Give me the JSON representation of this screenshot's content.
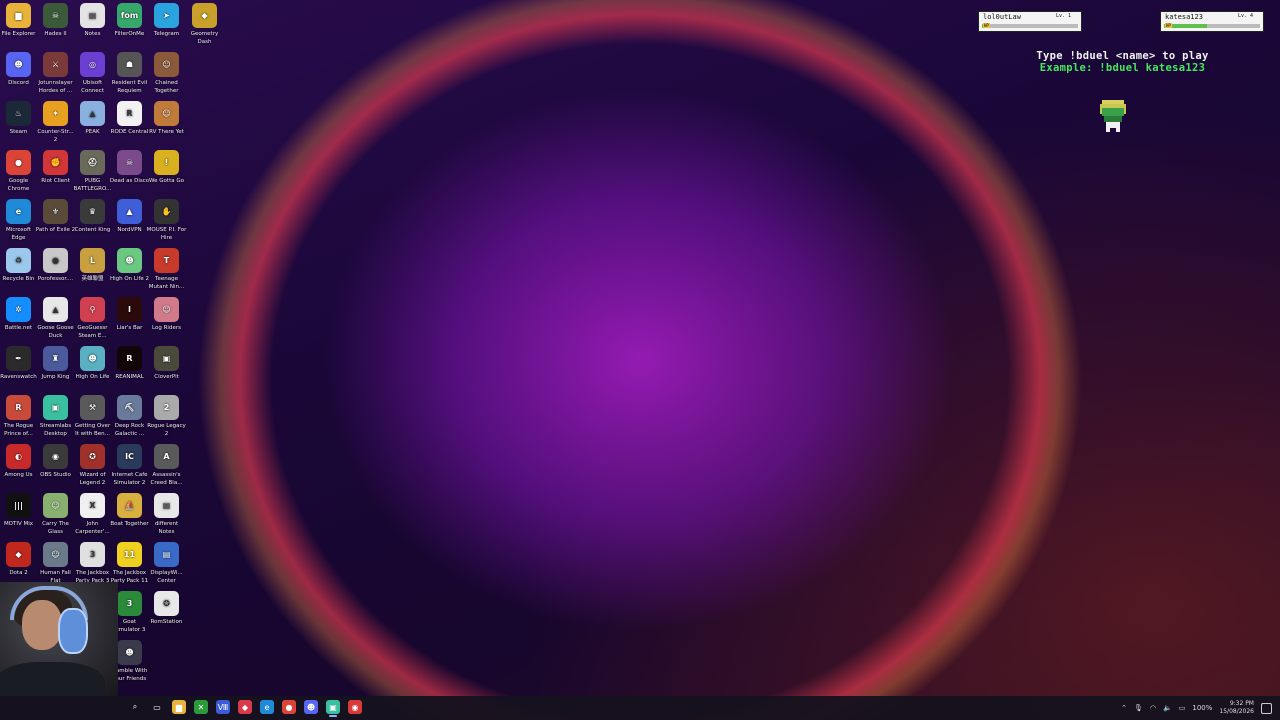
{
  "desktop": {
    "icons": [
      {
        "label": "File Explorer",
        "col": 0,
        "row": 0,
        "color": "#e8b33a",
        "glyph": "▆"
      },
      {
        "label": "Hades II",
        "col": 1,
        "row": 0,
        "color": "#3a5a3a",
        "glyph": "☠"
      },
      {
        "label": "Notes",
        "col": 2,
        "row": 0,
        "color": "#e4e4e4",
        "glyph": "▤"
      },
      {
        "label": "FilterOnMe",
        "col": 3,
        "row": 0,
        "color": "#36a86b",
        "glyph": "fom"
      },
      {
        "label": "Telegram",
        "col": 4,
        "row": 0,
        "color": "#2aa3df",
        "glyph": "➤"
      },
      {
        "label": "Geometry Dash",
        "col": 5,
        "row": 0,
        "color": "#c9a12a",
        "glyph": "◆"
      },
      {
        "label": "Discord",
        "col": 0,
        "row": 1,
        "color": "#5865f2",
        "glyph": "☻"
      },
      {
        "label": "Jotunnslayer Hordes of ...",
        "col": 1,
        "row": 1,
        "color": "#7a3a3a",
        "glyph": "⚔"
      },
      {
        "label": "Ubisoft Connect",
        "col": 2,
        "row": 1,
        "color": "#6b3fd1",
        "glyph": "◎"
      },
      {
        "label": "Resident Evil Requiem",
        "col": 3,
        "row": 1,
        "color": "#555",
        "glyph": "☗"
      },
      {
        "label": "Chained Together",
        "col": 4,
        "row": 1,
        "color": "#8a5a3a",
        "glyph": "☺"
      },
      {
        "label": "Steam",
        "col": 0,
        "row": 2,
        "color": "#1b2838",
        "glyph": "♨"
      },
      {
        "label": "Counter-Str... 2",
        "col": 1,
        "row": 2,
        "color": "#e8a020",
        "glyph": "✦"
      },
      {
        "label": "PEAK",
        "col": 2,
        "row": 2,
        "color": "#8ab0e0",
        "glyph": "▲"
      },
      {
        "label": "RODE Central",
        "col": 3,
        "row": 2,
        "color": "#f2f2f2",
        "glyph": "R"
      },
      {
        "label": "RV There Yet",
        "col": 4,
        "row": 2,
        "color": "#c07a3a",
        "glyph": "☺"
      },
      {
        "label": "Google Chrome",
        "col": 0,
        "row": 3,
        "color": "#db4437",
        "glyph": "●"
      },
      {
        "label": "Riot Client",
        "col": 1,
        "row": 3,
        "color": "#d13639",
        "glyph": "✊"
      },
      {
        "label": "PUBG BATTLEGRO...",
        "col": 2,
        "row": 3,
        "color": "#6a6a5a",
        "glyph": "⛑"
      },
      {
        "label": "Dead as Disco",
        "col": 3,
        "row": 3,
        "color": "#7a4a8a",
        "glyph": "☠"
      },
      {
        "label": "We Gotta Go",
        "col": 4,
        "row": 3,
        "color": "#d8b020",
        "glyph": "!"
      },
      {
        "label": "Microsoft Edge",
        "col": 0,
        "row": 4,
        "color": "#1e8ad8",
        "glyph": "e"
      },
      {
        "label": "Path of Exile 2",
        "col": 1,
        "row": 4,
        "color": "#5a4a3a",
        "glyph": "⚜"
      },
      {
        "label": "Content King",
        "col": 2,
        "row": 4,
        "color": "#3a3a3a",
        "glyph": "♛"
      },
      {
        "label": "NordVPN",
        "col": 3,
        "row": 4,
        "color": "#3e5fd8",
        "glyph": "▲"
      },
      {
        "label": "MOUSE P.I. For Hire",
        "col": 4,
        "row": 4,
        "color": "#333",
        "glyph": "✋"
      },
      {
        "label": "Recycle Bin",
        "col": 0,
        "row": 5,
        "color": "#9bc8ec",
        "glyph": "♻"
      },
      {
        "label": "Porofessor....",
        "col": 1,
        "row": 5,
        "color": "#c8c8c8",
        "glyph": "●"
      },
      {
        "label": "英雄聯盟",
        "col": 2,
        "row": 5,
        "color": "#c8a040",
        "glyph": "L"
      },
      {
        "label": "High On Life 2",
        "col": 3,
        "row": 5,
        "color": "#6ac880",
        "glyph": "☻"
      },
      {
        "label": "Teenage Mutant Nin...",
        "col": 4,
        "row": 5,
        "color": "#c83a2a",
        "glyph": "T"
      },
      {
        "label": "Battle.net",
        "col": 0,
        "row": 6,
        "color": "#148eff",
        "glyph": "✲"
      },
      {
        "label": "Goose Goose Duck",
        "col": 1,
        "row": 6,
        "color": "#e8e8e8",
        "glyph": "▲"
      },
      {
        "label": "GeoGuessr Steam E...",
        "col": 2,
        "row": 6,
        "color": "#d04050",
        "glyph": "⚲"
      },
      {
        "label": "Liar's Bar",
        "col": 3,
        "row": 6,
        "color": "#2a0a0a",
        "glyph": "I"
      },
      {
        "label": "Log Riders",
        "col": 4,
        "row": 6,
        "color": "#d07a8a",
        "glyph": "☺"
      },
      {
        "label": "Ravenswatch",
        "col": 0,
        "row": 7,
        "color": "#2a2a2a",
        "glyph": "✒"
      },
      {
        "label": "Jump King",
        "col": 1,
        "row": 7,
        "color": "#4a5a9a",
        "glyph": "♜"
      },
      {
        "label": "High On Life",
        "col": 2,
        "row": 7,
        "color": "#5ab0c0",
        "glyph": "☻"
      },
      {
        "label": "REANIMAL",
        "col": 3,
        "row": 7,
        "color": "#110505",
        "glyph": "R"
      },
      {
        "label": "CloverPit",
        "col": 4,
        "row": 7,
        "color": "#4a4a3a",
        "glyph": "▣"
      },
      {
        "label": "The Rogue Prince of...",
        "col": 0,
        "row": 8,
        "color": "#c84a3a",
        "glyph": "R"
      },
      {
        "label": "Streamlabs Desktop",
        "col": 1,
        "row": 8,
        "color": "#3ac0a0",
        "glyph": "▣"
      },
      {
        "label": "Getting Over It with Ben...",
        "col": 2,
        "row": 8,
        "color": "#5a5a5a",
        "glyph": "⚒"
      },
      {
        "label": "Deep Rock Galactic ...",
        "col": 3,
        "row": 8,
        "color": "#6a7a9a",
        "glyph": "⛏"
      },
      {
        "label": "Rogue Legacy 2",
        "col": 4,
        "row": 8,
        "color": "#aaaaaa",
        "glyph": "2"
      },
      {
        "label": "Among Us",
        "col": 0,
        "row": 9,
        "color": "#c82a2a",
        "glyph": "◐"
      },
      {
        "label": "OBS Studio",
        "col": 1,
        "row": 9,
        "color": "#3a3a3a",
        "glyph": "◉"
      },
      {
        "label": "Wizard of Legend 2",
        "col": 2,
        "row": 9,
        "color": "#a0302a",
        "glyph": "✪"
      },
      {
        "label": "Internet Cafe Simulator 2",
        "col": 3,
        "row": 9,
        "color": "#2a3a5a",
        "glyph": "IC"
      },
      {
        "label": "Assassin's Creed Bla...",
        "col": 4,
        "row": 9,
        "color": "#5a5a5a",
        "glyph": "A"
      },
      {
        "label": "MOTIV Mix",
        "col": 0,
        "row": 10,
        "color": "#111",
        "glyph": "|||"
      },
      {
        "label": "Carry The Glass",
        "col": 1,
        "row": 10,
        "color": "#8ab070",
        "glyph": "☺"
      },
      {
        "label": "John Carpenter'...",
        "col": 2,
        "row": 10,
        "color": "#f0f0f0",
        "glyph": "X"
      },
      {
        "label": "Boat Together",
        "col": 3,
        "row": 10,
        "color": "#d8b040",
        "glyph": "⛵"
      },
      {
        "label": "different Notes",
        "col": 4,
        "row": 10,
        "color": "#e8e8e8",
        "glyph": "▤"
      },
      {
        "label": "Dota 2",
        "col": 0,
        "row": 11,
        "color": "#c0281e",
        "glyph": "◆"
      },
      {
        "label": "Human Fall Flat",
        "col": 1,
        "row": 11,
        "color": "#6a7a8a",
        "glyph": "☺"
      },
      {
        "label": "The Jackbox Party Pack 3",
        "col": 2,
        "row": 11,
        "color": "#e0e0e0",
        "glyph": "3"
      },
      {
        "label": "The Jackbox Party Pack 11",
        "col": 3,
        "row": 11,
        "color": "#f0d020",
        "glyph": "11"
      },
      {
        "label": "DisplayWi... Center",
        "col": 4,
        "row": 11,
        "color": "#3a6ac8",
        "glyph": "▤"
      },
      {
        "label": "Goat Simulator 3",
        "col": 3,
        "row": 12,
        "color": "#2a8a3a",
        "glyph": "3"
      },
      {
        "label": "RomStation",
        "col": 4,
        "row": 12,
        "color": "#e8e8e8",
        "glyph": "✪"
      },
      {
        "label": "Gamble With Your Friends",
        "col": 3,
        "row": 13,
        "color": "#3a3a4a",
        "glyph": "☻"
      }
    ]
  },
  "overlay": {
    "players": [
      {
        "name": "lol0utLaw",
        "level": "Lv. 1",
        "hp_label": "HP",
        "hp_fraction": 0.05
      },
      {
        "name": "katesa123",
        "level": "Lv. 4",
        "hp_label": "HP",
        "hp_fraction": 0.45
      }
    ],
    "instruction_line1": "Type !bduel <name> to play",
    "instruction_line2": "Example: !bduel katesa123"
  },
  "taskbar": {
    "icons": [
      {
        "name": "search-icon",
        "glyph": "⌕",
        "color": "transparent"
      },
      {
        "name": "task-view-icon",
        "glyph": "▭",
        "color": "transparent"
      },
      {
        "name": "file-explorer-icon",
        "glyph": "▆",
        "color": "#e8b33a"
      },
      {
        "name": "xbox-icon",
        "glyph": "✕",
        "color": "#2a9a3a"
      },
      {
        "name": "app-icon",
        "glyph": "Ⅷ",
        "color": "#3a5ad8"
      },
      {
        "name": "app-icon-red",
        "glyph": "◆",
        "color": "#d83a4a"
      },
      {
        "name": "edge-icon",
        "glyph": "e",
        "color": "#1e8ad8"
      },
      {
        "name": "chrome-icon",
        "glyph": "●",
        "color": "#db4437"
      },
      {
        "name": "discord-icon",
        "glyph": "☻",
        "color": "#5865f2"
      },
      {
        "name": "streamlabs-icon",
        "glyph": "▣",
        "color": "#3ac0a0"
      },
      {
        "name": "obs-icon",
        "glyph": "◉",
        "color": "#d83a3a"
      }
    ],
    "battery": "100%",
    "time": "9:32 PM",
    "date": "15/08/2026"
  }
}
